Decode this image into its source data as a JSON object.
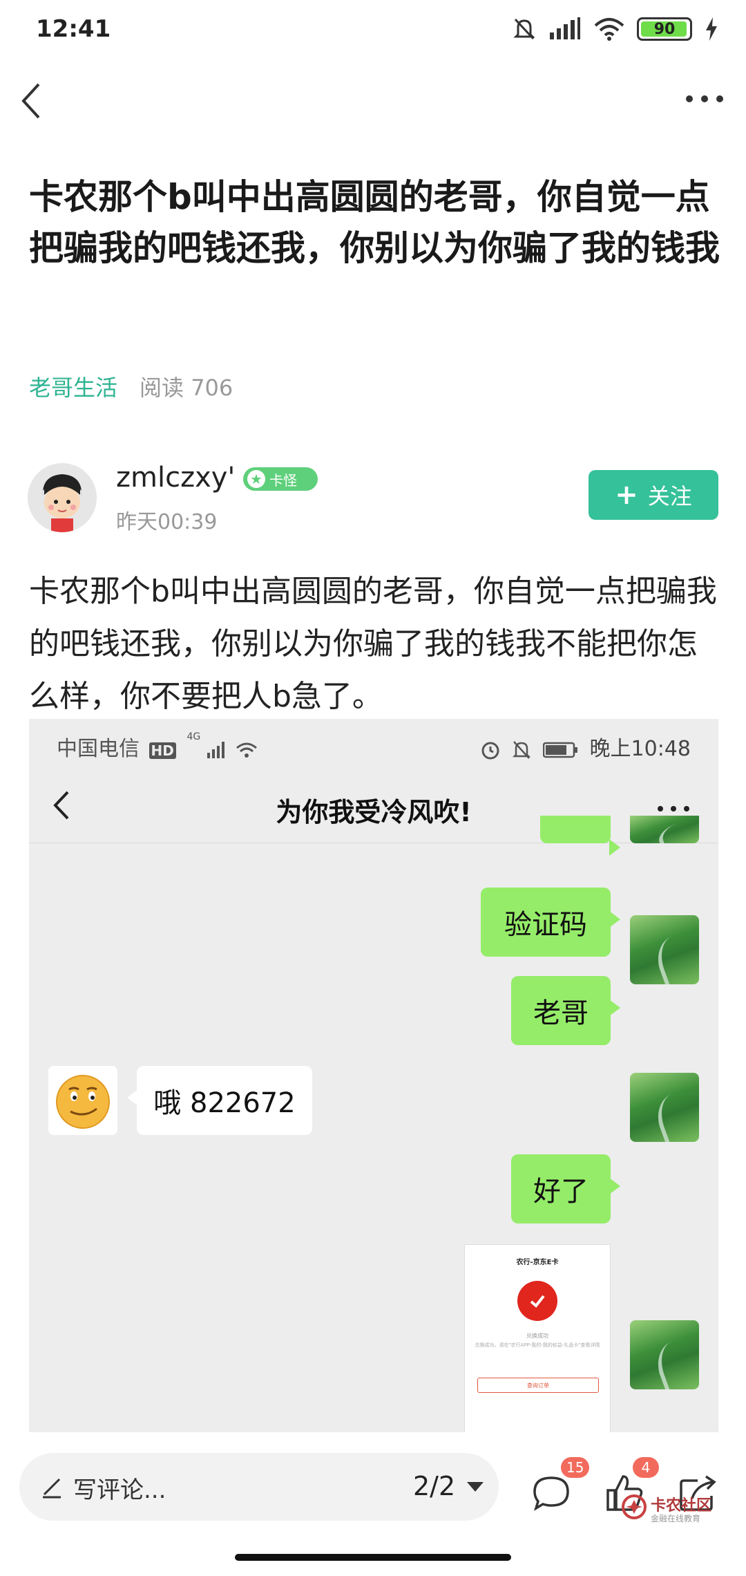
{
  "status_bar": {
    "time": "12:41",
    "battery": "90",
    "icons": [
      "bell-off-icon",
      "signal-icon",
      "wifi-icon",
      "battery-icon",
      "charging-icon"
    ]
  },
  "nav": {
    "back_icon": "chevron-left-icon",
    "more_icon": "more-horizontal-icon"
  },
  "post": {
    "title": "卡农那个b叫中出高圆圆的老哥，你自觉一点把骗我的吧钱还我，你别以为你骗了我的钱我",
    "category": "老哥生活",
    "reads": "阅读 706",
    "author": {
      "name": "zmlczxy'",
      "badge": "卡怪",
      "time": "昨天00:39"
    },
    "follow_label": "关注",
    "body": "卡农那个b叫中出高圆圆的老哥，你自觉一点把骗我的吧钱还我，你别以为你骗了我的钱我不能把你怎么样，你不要把人b急了。"
  },
  "screenshot": {
    "carrier": "中国电信",
    "hd": "HD",
    "net": "4G",
    "clock": "晚上10:48",
    "chat_title": "为你我受冷风吹!",
    "messages": [
      {
        "from": "me",
        "text": "验证码"
      },
      {
        "from": "me",
        "text": "老哥"
      },
      {
        "from": "other",
        "text": "哦 822672"
      },
      {
        "from": "me",
        "text": "好了"
      }
    ],
    "image_message": {
      "title": "农行-京东E卡",
      "ok": "兑换成功",
      "desc": "兑换成功，请在\"农行APP-我的-我的权益-礼品卡\"查看详情",
      "button": "查询订单"
    }
  },
  "bottom_bar": {
    "comment_placeholder": "写评论...",
    "pager": "2/2",
    "comment_count": "15",
    "like_count": "4",
    "watermark": "卡农社区",
    "watermark_sub": "金融在线教育"
  }
}
